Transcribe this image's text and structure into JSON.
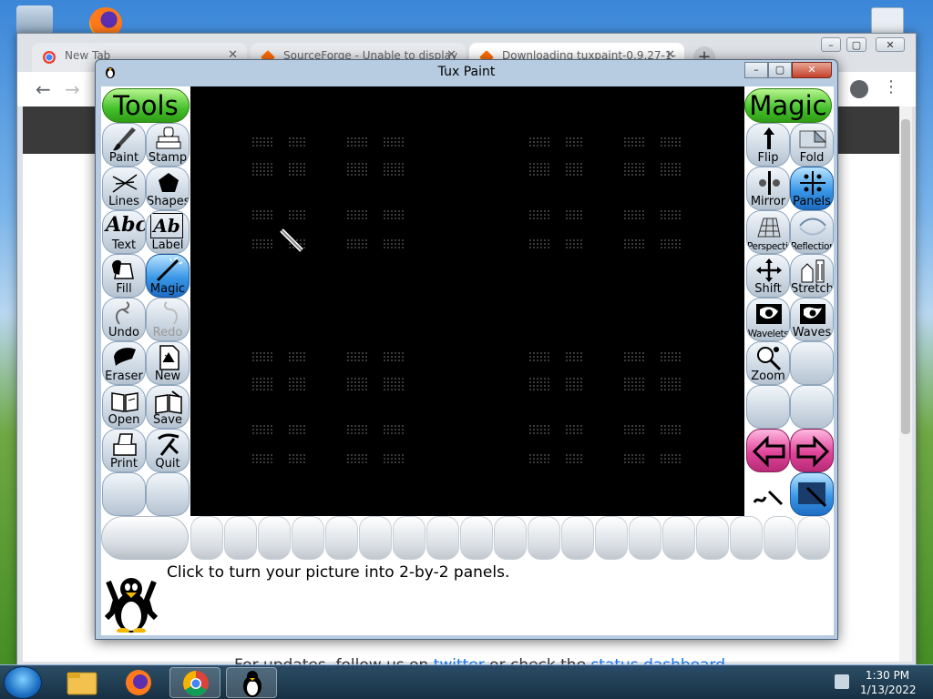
{
  "browser": {
    "tabs": [
      {
        "label": "New Tab"
      },
      {
        "label": "SourceForge - Unable to display"
      },
      {
        "label": "Downloading tuxpaint-0.9.27-1-"
      }
    ],
    "new_tab_label": "+",
    "footer_text": "For updates, follow us on",
    "footer_link1": "twitter",
    "footer_mid": "or check the",
    "footer_link2": "status dashboard"
  },
  "tuxpaint": {
    "title": "Tux Paint",
    "tools_header": "Tools",
    "magic_header": "Magic",
    "tools": [
      {
        "label": "Paint"
      },
      {
        "label": "Stamp"
      },
      {
        "label": "Lines"
      },
      {
        "label": "Shapes"
      },
      {
        "label": "Text"
      },
      {
        "label": "Label"
      },
      {
        "label": "Fill"
      },
      {
        "label": "Magic"
      },
      {
        "label": "Undo"
      },
      {
        "label": "Redo"
      },
      {
        "label": "Eraser"
      },
      {
        "label": "New"
      },
      {
        "label": "Open"
      },
      {
        "label": "Save"
      },
      {
        "label": "Print"
      },
      {
        "label": "Quit"
      }
    ],
    "text_icon_1": "Abc",
    "text_icon_2": "Ab",
    "magic": [
      {
        "label": "Flip"
      },
      {
        "label": "Fold"
      },
      {
        "label": "Mirror"
      },
      {
        "label": "Panels"
      },
      {
        "label": "Perspective"
      },
      {
        "label": "Reflection"
      },
      {
        "label": "Shift"
      },
      {
        "label": "Stretch"
      },
      {
        "label": "Wavelets"
      },
      {
        "label": "Waves"
      },
      {
        "label": "Zoom"
      }
    ],
    "tip": "Click to turn your picture into 2-by-2 panels."
  },
  "taskbar": {
    "time": "1:30 PM",
    "date": "1/13/2022"
  }
}
